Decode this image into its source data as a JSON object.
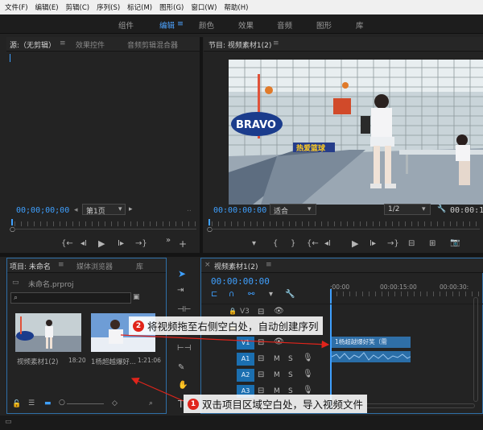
{
  "menu": [
    "文件(F)",
    "编辑(E)",
    "剪辑(C)",
    "序列(S)",
    "标记(M)",
    "图形(G)",
    "窗口(W)",
    "帮助(H)"
  ],
  "workspaces": [
    {
      "label": "组件",
      "active": false
    },
    {
      "label": "编辑",
      "active": true
    },
    {
      "label": "颜色",
      "active": false
    },
    {
      "label": "效果",
      "active": false
    },
    {
      "label": "音频",
      "active": false
    },
    {
      "label": "图形",
      "active": false
    },
    {
      "label": "库",
      "active": false
    }
  ],
  "source_panel": {
    "tabs": [
      "源:（无剪辑）",
      "效果控件",
      "音频剪辑混合器"
    ],
    "timecode": "00;00;00;00",
    "page": "第1页"
  },
  "program_panel": {
    "tab": "节目: 视频素材1(2)",
    "timecode": "00:00:00:00",
    "fit": "适合",
    "resolution": "1/2",
    "timecode_right": "00:00:18",
    "scene_text": {
      "bravo": "BRAVO",
      "brand": "热爱篮球"
    }
  },
  "project_panel": {
    "tabs": [
      "项目: 未命名",
      "媒体浏览器",
      "库"
    ],
    "file": "未命名.prproj",
    "items": [
      {
        "name": "视频素材1(2)",
        "duration": "18:20"
      },
      {
        "name": "1杨超越爆好...",
        "duration": "1:21:06"
      }
    ]
  },
  "timeline_panel": {
    "tab": "视频素材1(2)",
    "timecode": "00:00:00:00",
    "ruler": [
      ":00:00",
      "00:00:15:00",
      "00:00:30:"
    ],
    "tracks": [
      "V3",
      "V2",
      "V1",
      "A1",
      "A2",
      "A3"
    ],
    "clip_label": "1杨超越爆好笑（需",
    "track_buttons": [
      "M",
      "S"
    ]
  },
  "callouts": [
    {
      "num": "2",
      "text": "将视频拖至右侧空白处，自动创建序列"
    },
    {
      "num": "1",
      "text": "双击项目区域空白处，导入视频文件"
    }
  ],
  "colors": {
    "accent": "#3fa0ff",
    "track_badge": "#1b6fb0",
    "callout_red": "#e0241b",
    "clip": "#2f6fa7"
  },
  "icons": [
    "play-icon",
    "step-back-icon",
    "step-forward-icon",
    "marker-icon",
    "wrench-icon",
    "camera-icon",
    "selection-tool-icon",
    "pen-tool-icon",
    "hand-tool-icon",
    "type-tool-icon",
    "search-icon",
    "eye-icon",
    "lock-icon",
    "mic-icon"
  ]
}
